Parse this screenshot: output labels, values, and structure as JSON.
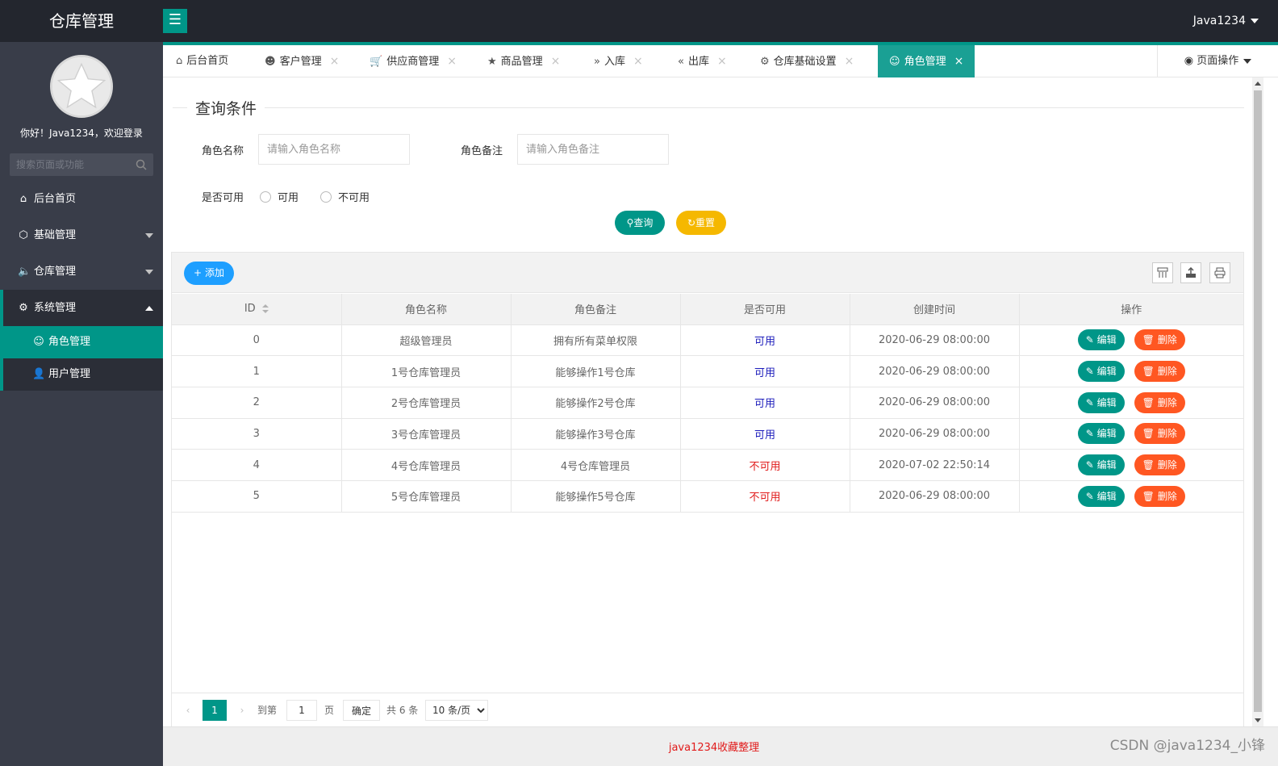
{
  "header": {
    "app_title": "仓库管理",
    "menu_icon": "hamburger-icon",
    "user_name": "Java1234"
  },
  "sidebar": {
    "welcome": "你好！Java1234，欢迎登录",
    "search_placeholder": "搜索页面或功能",
    "items": [
      {
        "label": "后台首页",
        "icon": "home-icon"
      },
      {
        "label": "基础管理",
        "icon": "cube-icon"
      },
      {
        "label": "仓库管理",
        "icon": "speaker-icon"
      },
      {
        "label": "系统管理",
        "icon": "gear-icon"
      }
    ],
    "subitems": [
      {
        "label": "角色管理",
        "icon": "smile-icon"
      },
      {
        "label": "用户管理",
        "icon": "user-icon"
      }
    ]
  },
  "tabs": [
    {
      "label": "后台首页",
      "icon": "home-icon"
    },
    {
      "label": "客户管理",
      "icon": "user-icon"
    },
    {
      "label": "供应商管理",
      "icon": "cart-icon"
    },
    {
      "label": "商品管理",
      "icon": "star-icon"
    },
    {
      "label": "入库",
      "icon": "double-right-icon"
    },
    {
      "label": "出库",
      "icon": "double-left-icon"
    },
    {
      "label": "仓库基础设置",
      "icon": "gear-icon"
    },
    {
      "label": "角色管理",
      "icon": "smile-icon"
    }
  ],
  "page_ops_label": "页面操作",
  "query": {
    "legend": "查询条件",
    "role_name_label": "角色名称",
    "role_name_placeholder": "请输入角色名称",
    "role_remark_label": "角色备注",
    "role_remark_placeholder": "请输入角色备注",
    "available_label": "是否可用",
    "radio_yes": "可用",
    "radio_no": "不可用",
    "search_button": "查询",
    "reset_button": "重置"
  },
  "toolbar": {
    "add_button": "添加"
  },
  "table": {
    "columns": [
      "ID",
      "角色名称",
      "角色备注",
      "是否可用",
      "创建时间",
      "操作"
    ],
    "edit_label": "编辑",
    "delete_label": "删除",
    "rows": [
      {
        "id": "0",
        "name": "超级管理员",
        "remark": "拥有所有菜单权限",
        "available": "可用",
        "created": "2020-06-29 08:00:00"
      },
      {
        "id": "1",
        "name": "1号仓库管理员",
        "remark": "能够操作1号仓库",
        "available": "可用",
        "created": "2020-06-29 08:00:00"
      },
      {
        "id": "2",
        "name": "2号仓库管理员",
        "remark": "能够操作2号仓库",
        "available": "可用",
        "created": "2020-06-29 08:00:00"
      },
      {
        "id": "3",
        "name": "3号仓库管理员",
        "remark": "能够操作3号仓库",
        "available": "可用",
        "created": "2020-06-29 08:00:00"
      },
      {
        "id": "4",
        "name": "4号仓库管理员",
        "remark": "4号仓库管理员",
        "available": "不可用",
        "created": "2020-07-02 22:50:14"
      },
      {
        "id": "5",
        "name": "5号仓库管理员",
        "remark": "能够操作5号仓库",
        "available": "不可用",
        "created": "2020-06-29 08:00:00"
      }
    ]
  },
  "pagination": {
    "current_page": "1",
    "goto_label": "到第",
    "goto_value": "1",
    "page_unit": "页",
    "confirm_button": "确定",
    "total": "共 6 条",
    "page_size": "10 条/页"
  },
  "footer": {
    "copyright": "java1234收藏整理"
  },
  "watermark": "CSDN @java1234_小锋",
  "colors": {
    "accent": "#009688",
    "header_bg": "#23262e",
    "sidebar_bg": "#393d49",
    "yellow": "#f5b800",
    "blue": "#1e9fff",
    "danger": "#ff5722"
  }
}
